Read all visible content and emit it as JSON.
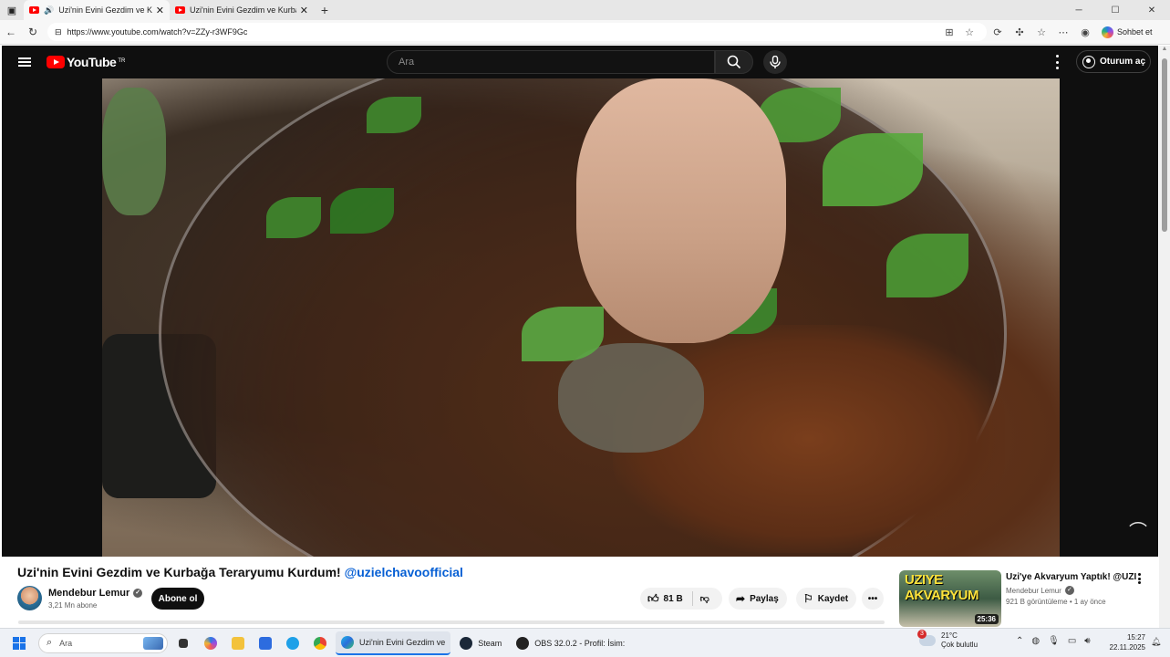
{
  "browser": {
    "tabs": [
      {
        "title": "Uzi'nin Evini Gezdim ve Kurb",
        "active": true
      },
      {
        "title": "Uzi'nin Evini Gezdim ve Kurbağa T",
        "active": false
      }
    ],
    "url": "https://www.youtube.com/watch?v=ZZy-r3WF9Gc",
    "copilot_label": "Sohbet et"
  },
  "youtube": {
    "logo_text": "YouTube",
    "country_code": "TR",
    "search_placeholder": "Ara",
    "signin_label": "Oturum aç"
  },
  "video": {
    "title": "Uzi'nin Evini Gezdim ve Kurbağa Teraryumu Kurdum!",
    "mention": "@uzielchavoofficial",
    "channel_name": "Mendebur Lemur",
    "subscribers": "3,21 Mn abone",
    "subscribe_label": "Abone ol",
    "likes": "81 B",
    "share_label": "Paylaş",
    "save_label": "Kaydet"
  },
  "recommended": {
    "thumb_text": "UZIYE AKVARYUM",
    "duration": "25:36",
    "title": "Uzi'ye Akvaryum Yaptık! @UZI",
    "channel": "Mendebur Lemur",
    "views": "921 B görüntüleme",
    "age": "1 ay önce"
  },
  "taskbar": {
    "search_placeholder": "Ara",
    "active_window": "Uzi'nin Evini Gezdim ve",
    "steam_label": "Steam",
    "obs_label": "OBS 32.0.2 - Profil: İsim:",
    "weather_temp": "21°C",
    "weather_desc": "Çok bulutlu",
    "weather_badge": "3",
    "time": "15:27",
    "date": "22.11.2025"
  },
  "colors": {
    "yt_red": "#ff0000",
    "yt_dark": "#0f0f0f",
    "mention_blue": "#065fd4",
    "accent": "#1a73e8"
  }
}
